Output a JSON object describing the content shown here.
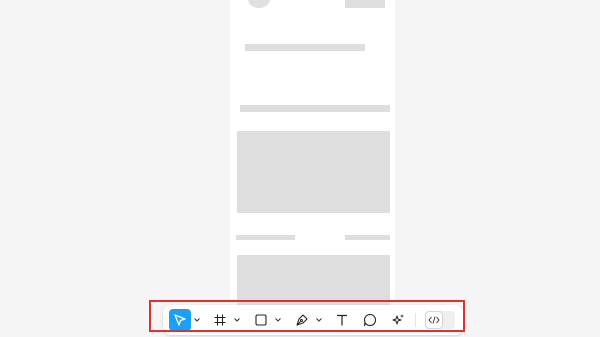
{
  "canvas": {
    "background_color": "#f5f5f5",
    "frame_color": "#ffffff",
    "placeholder_color": "#dedede"
  },
  "toolbar": {
    "tools": [
      {
        "name": "move-tool",
        "icon": "cursor-arrow-icon",
        "active": true,
        "has_dropdown": true
      },
      {
        "name": "frame-tool",
        "icon": "hash-frame-icon",
        "active": false,
        "has_dropdown": true
      },
      {
        "name": "shape-tool",
        "icon": "rectangle-icon",
        "active": false,
        "has_dropdown": true
      },
      {
        "name": "pen-tool",
        "icon": "pen-nib-icon",
        "active": false,
        "has_dropdown": true
      },
      {
        "name": "text-tool",
        "icon": "text-t-icon",
        "active": false,
        "has_dropdown": false
      },
      {
        "name": "comment-tool",
        "icon": "speech-bubble-icon",
        "active": false,
        "has_dropdown": false
      },
      {
        "name": "actions-tool",
        "icon": "sparkle-icon",
        "active": false,
        "has_dropdown": false
      }
    ],
    "dev_mode_toggle": {
      "icon": "code-brackets-icon",
      "enabled": false
    },
    "accent_color": "#18a0fb",
    "highlight_color": "#e0312f"
  }
}
